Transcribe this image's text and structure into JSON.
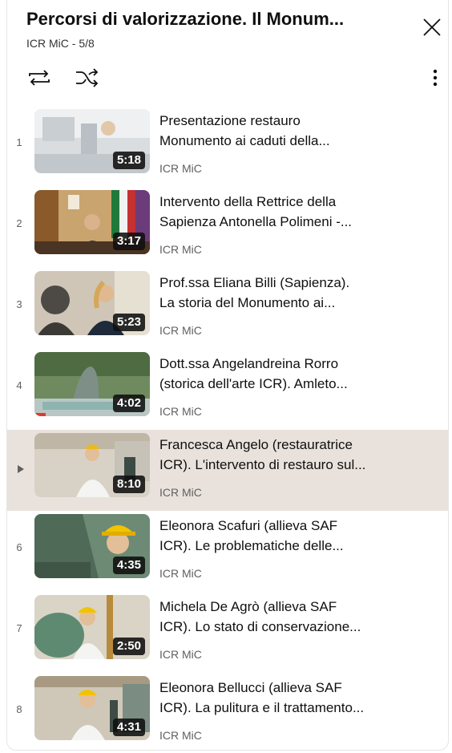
{
  "playlist": {
    "title": "Percorsi di valorizzazione. Il Monum...",
    "subtitle": "ICR MiC - 5/8"
  },
  "icons": {
    "close": "close-icon",
    "loop": "loop-icon",
    "shuffle": "shuffle-icon",
    "more": "more-vert-icon",
    "now_playing": "play-triangle-icon"
  },
  "colors": {
    "active_row": "#e9e2dc",
    "duration_bg": "#0f0f0f"
  },
  "videos": [
    {
      "index": "1",
      "duration": "5:18",
      "line1": "Presentazione restauro",
      "line2": "Monumento ai caduti della...",
      "channel": "ICR MiC",
      "active": false
    },
    {
      "index": "2",
      "duration": "3:17",
      "line1": "Intervento della Rettrice della",
      "line2": "Sapienza Antonella Polimeni -...",
      "channel": "ICR MiC",
      "active": false
    },
    {
      "index": "3",
      "duration": "5:23",
      "line1": "Prof.ssa Eliana Billi (Sapienza).",
      "line2": "La storia del Monumento ai...",
      "channel": "ICR MiC",
      "active": false
    },
    {
      "index": "4",
      "duration": "4:02",
      "line1": "Dott.ssa Angelandreina Rorro",
      "line2": "(storica dell'arte ICR). Amleto...",
      "channel": "ICR MiC",
      "active": false
    },
    {
      "index": "",
      "duration": "8:10",
      "line1": "Francesca Angelo (restauratrice",
      "line2": "ICR). L'intervento di restauro sul...",
      "channel": "ICR MiC",
      "active": true
    },
    {
      "index": "6",
      "duration": "4:35",
      "line1": "Eleonora Scafuri (allieva SAF",
      "line2": "ICR). Le problematiche delle...",
      "channel": "ICR MiC",
      "active": false
    },
    {
      "index": "7",
      "duration": "2:50",
      "line1": "Michela De Agrò (allieva SAF",
      "line2": "ICR). Lo stato di conservazione...",
      "channel": "ICR MiC",
      "active": false
    },
    {
      "index": "8",
      "duration": "4:31",
      "line1": "Eleonora Bellucci (allieva SAF",
      "line2": "ICR). La pulitura e il trattamento...",
      "channel": "ICR MiC",
      "active": false
    }
  ]
}
